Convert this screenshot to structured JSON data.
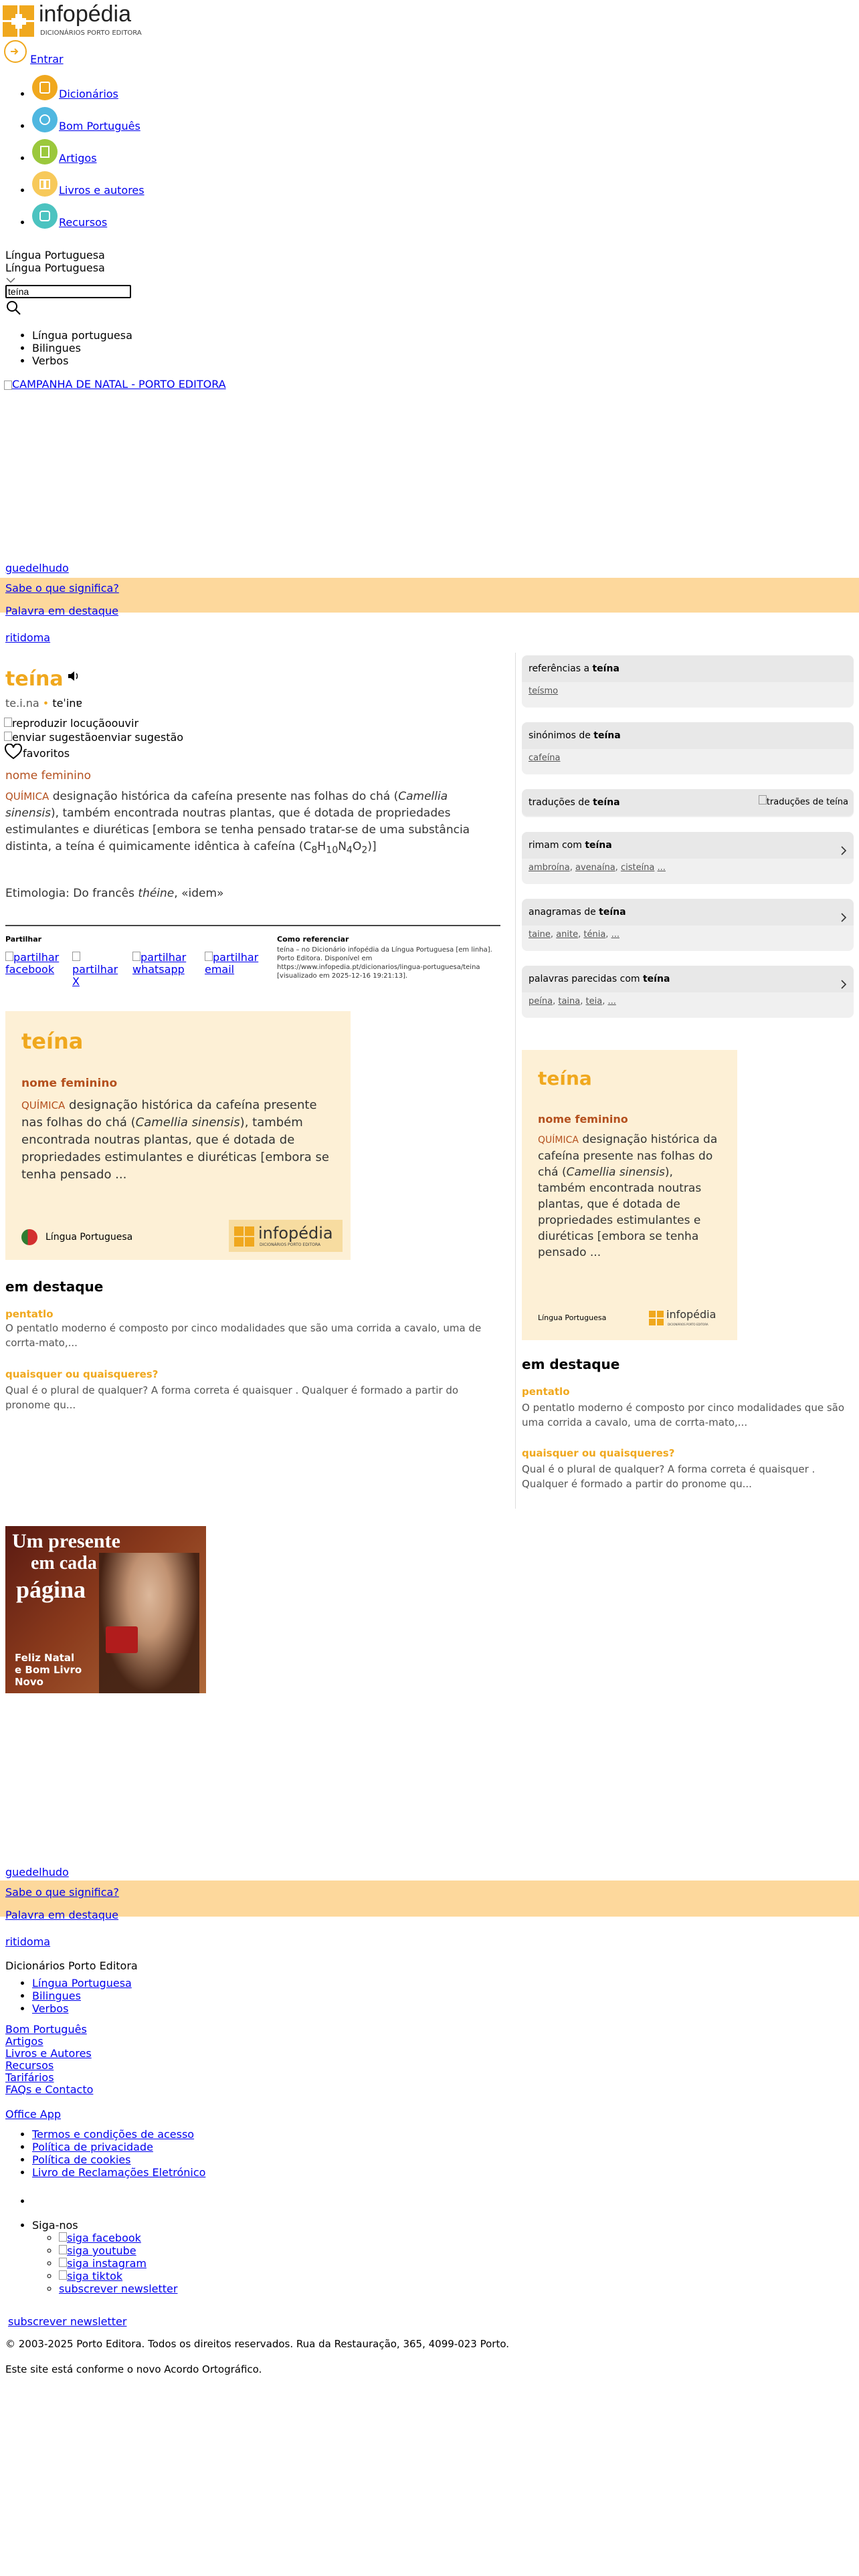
{
  "brand": {
    "name": "infopédia",
    "tagline": "DICIONÁRIOS PORTO EDITORA"
  },
  "header": {
    "login_label": "Entrar"
  },
  "nav": {
    "items": [
      {
        "label": "Dicionários",
        "color": "#f0a81e"
      },
      {
        "label": "Bom Português",
        "color": "#4fb7e0"
      },
      {
        "label": "Artigos",
        "color": "#9bc83c"
      },
      {
        "label": "Livros e autores",
        "color": "#f7c95a"
      },
      {
        "label": "Recursos",
        "color": "#4cc3c0"
      }
    ]
  },
  "search": {
    "dictionary_selected": "Língua Portuguesa",
    "dictionary_current": "Língua Portuguesa",
    "value": "teína",
    "options": [
      "Língua portuguesa",
      "Bilingues",
      "Verbos"
    ]
  },
  "promo": {
    "link_label": "CAMPANHA DE NATAL - PORTO EDITORA"
  },
  "featured_bar": {
    "word": "guedelhudo",
    "question": "Sabe o que significa?",
    "label": "Palavra em destaque",
    "word2": "ritidoma"
  },
  "entry": {
    "headword": "teína",
    "syllables": "te.i.na",
    "pronunciation": "teˈinɐ",
    "audio_alt": "reproduzir locução",
    "audio_label": "ouvir",
    "suggest_alt": "enviar sugestão",
    "suggest_label": "enviar sugestão",
    "favorites_label": "favoritos",
    "pos": "nome feminino",
    "domain": "QUÍMICA",
    "definition_a": "designação histórica da cafeína presente nas folhas do chá (",
    "definition_italic": "Camellia sinensis",
    "definition_b": "), também encontrada noutras plantas, que é dotada de propriedades estimulantes e diuréticas [embora se tenha pensado tratar-se de uma substância distinta, a teína é quimicamente idêntica à cafeína (C",
    "formula_8": "8",
    "formula_h": "H",
    "formula_10": "10",
    "formula_n": "N",
    "formula_4": "4",
    "formula_o": "O",
    "formula_2": "2",
    "definition_end": ")]",
    "etymology_prefix": "Etimologia: Do francês ",
    "etymology_word": "théine",
    "etymology_suffix": ", «idem»"
  },
  "share": {
    "label": "Partilhar",
    "items": [
      "partilhar facebook",
      "partilhar X",
      "partilhar whatsapp",
      "partilhar email"
    ]
  },
  "cite": {
    "label": "Como referenciar",
    "text": "teína – no Dicionário infopédia da Língua Portuguesa [em linha]. Porto Editora. Disponível em https://www.infopedia.pt/dicionarios/lingua-portuguesa/teina [visualizado em 2025-12-16 19:21:13]."
  },
  "card": {
    "headword": "teína",
    "pos": "nome feminino",
    "domain": "QUÍMICA",
    "text_a": "designação histórica da cafeína presente nas folhas do chá (",
    "text_italic": "Camellia sinensis",
    "text_b": "), também encontrada noutras plantas, que é dotada de propriedades estimulantes e diuréticas [embora se tenha pensado ...",
    "footer": "Língua Portuguesa"
  },
  "highlights": {
    "title": "em destaque",
    "items": [
      {
        "title": "pentatlo",
        "text": "O pentatlo moderno é composto por cinco modalidades que são uma corrida a cavalo, uma de corrta-mato,..."
      },
      {
        "title": "quaisquer ou quaisqueres?",
        "text": "Qual é o plural de qualquer? A forma correta é quaisquer . Qualquer é formado a partir do pronome qu..."
      }
    ]
  },
  "highlights_side": {
    "title": "em destaque",
    "items": [
      {
        "title": "pentatlo",
        "text": "O pentatlo moderno é composto por cinco modalidades que são uma corrida a cavalo, uma de corrta-mato,..."
      },
      {
        "title": "quaisquer ou quaisqueres?",
        "text": "Qual é o plural de qualquer? A forma correta é quaisquer . Qualquer é formado a partir do pronome qu..."
      }
    ]
  },
  "sidebar": {
    "references": {
      "prefix": "referências a ",
      "word": "teína",
      "items": [
        "teísmo"
      ]
    },
    "synonyms": {
      "prefix": "sinónimos de ",
      "word": "teína",
      "items": [
        "cafeína"
      ]
    },
    "translations": {
      "prefix": "traduções de ",
      "word": "teína",
      "img_alt": "traduções de teína"
    },
    "rhymes": {
      "prefix": "rimam com ",
      "word": "teína",
      "items": [
        "ambroína",
        "avenaína",
        "cisteína",
        "..."
      ]
    },
    "anagrams": {
      "prefix": "anagramas de ",
      "word": "teína",
      "items": [
        "taine",
        "anite",
        "ténia",
        "..."
      ]
    },
    "similar": {
      "prefix": "palavras parecidas com ",
      "word": "teína",
      "items": [
        "peína",
        "taina",
        "teia",
        "..."
      ]
    }
  },
  "ad": {
    "line1": "Um presente",
    "line2": "em cada",
    "line3": "página",
    "sub1": "Feliz Natal",
    "sub2": "e Bom Livro",
    "sub3": "Novo"
  },
  "featured_bar_2": {
    "word": "guedelhudo",
    "question": "Sabe o que significa?",
    "label": "Palavra em destaque",
    "word2": "ritidoma"
  },
  "footer": {
    "section_title": "Dicionários Porto Editora",
    "dict_links": [
      "Língua Portuguesa",
      "Bilingues",
      "Verbos"
    ],
    "links": [
      "Bom Português",
      "Artigos",
      "Livros e Autores",
      "Recursos",
      "Tarifários",
      "FAQs e Contacto"
    ],
    "office_app": "Office App",
    "legal": [
      "Termos e condições de acesso",
      "Política de privacidade",
      "Política de cookies",
      "Livro de Reclamações Eletrónico"
    ],
    "follow_label": "Siga-nos",
    "social": [
      "siga facebook",
      "siga youtube",
      "siga instagram",
      "siga tiktok",
      "subscrever newsletter"
    ],
    "newsletter": "subscrever newsletter",
    "copyright": "© 2003-2025 Porto Editora. Todos os direitos reservados. Rua da Restauração, 365, 4099-023 Porto.",
    "ao_note": "Este site está conforme o novo Acordo Ortográfico."
  }
}
